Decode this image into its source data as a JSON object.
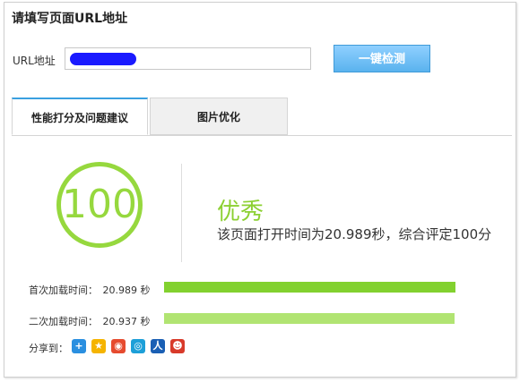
{
  "heading": "请填写页面URL地址",
  "url_label": "URL地址",
  "detect_button": "一键检测",
  "tabs": [
    {
      "label": "性能打分及问题建议",
      "active": true
    },
    {
      "label": "图片优化",
      "active": false
    }
  ],
  "score": "100",
  "grade": "优秀",
  "summary": "该页面打开时间为20.989秒，综合评定100分",
  "loads": [
    {
      "label": "首次加载时间：",
      "value": "20.989 秒",
      "color": "#82d12f"
    },
    {
      "label": "二次加载时间：",
      "value": "20.937 秒",
      "color": "#b1e472"
    }
  ],
  "share_label": "分享到：",
  "share_icons": [
    "plus-icon",
    "qzone-star-icon",
    "weibo-icon",
    "tencent-weibo-icon",
    "renren-icon",
    "kaixin-icon"
  ],
  "colors": {
    "accent_green": "#96d83e",
    "button_blue": "#5ab3ee",
    "tab_active_top": "#3aa0e0"
  }
}
